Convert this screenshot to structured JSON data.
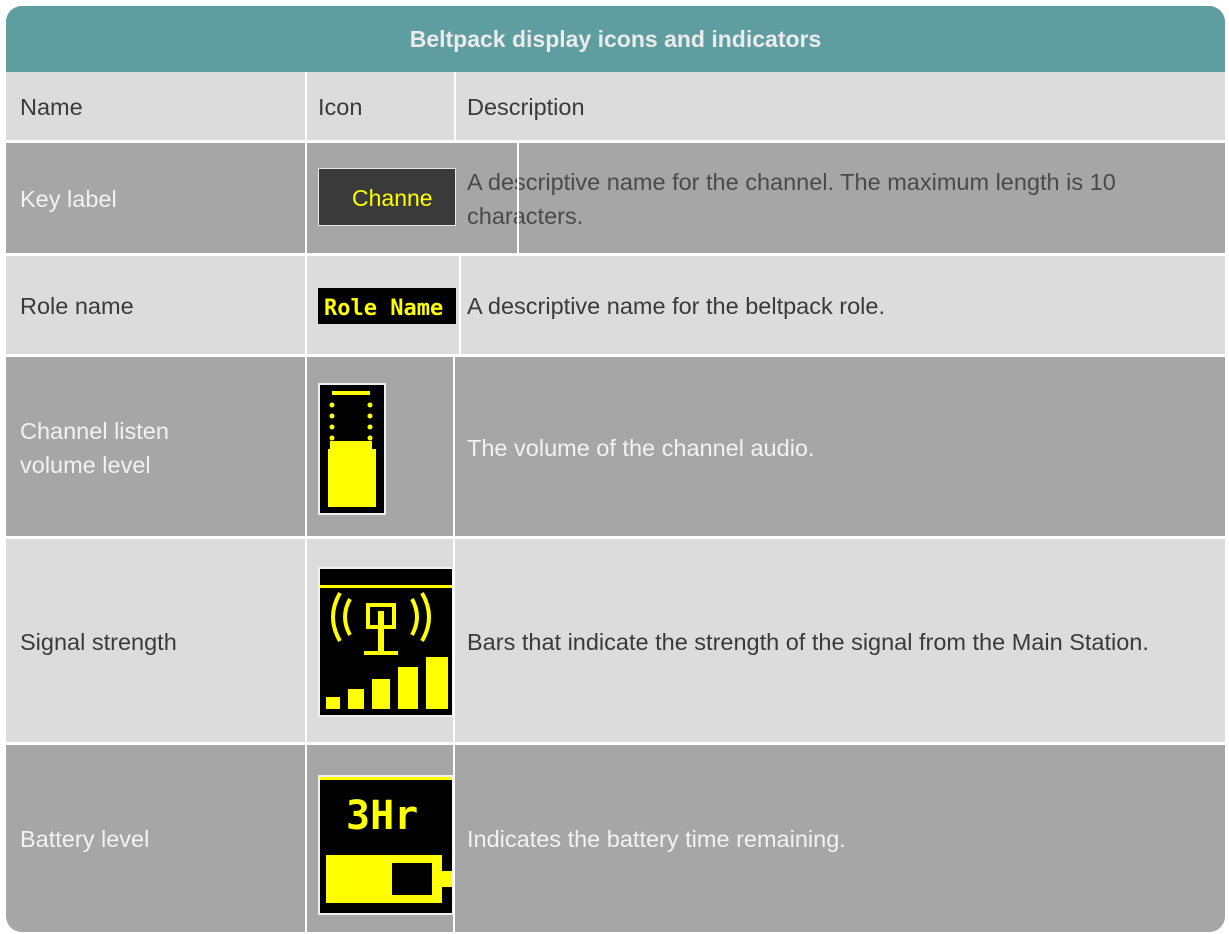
{
  "table": {
    "title": "Beltpack display icons and indicators",
    "headers": {
      "name": "Name",
      "icon": "Icon",
      "description": "Description"
    },
    "rows": [
      {
        "name": "Key label",
        "icon": "key-label-display-icon",
        "icon_text": "Channe",
        "description": "A descriptive name for the channel. The maximum length is 10 characters."
      },
      {
        "name": "Role name",
        "icon": "role-name-display-icon",
        "icon_text": "Role Name",
        "description": "A descriptive name for the beltpack role."
      },
      {
        "name": "Channel listen volume level",
        "icon": "volume-level-icon",
        "description": "The volume of the channel audio."
      },
      {
        "name": "Signal strength",
        "icon": "signal-strength-icon",
        "description": "Bars that indicate the strength of the signal from the Main Station."
      },
      {
        "name": "Battery level",
        "icon": "battery-level-icon",
        "icon_text": "3Hr",
        "description": "Indicates the battery time remaining."
      }
    ]
  },
  "colors": {
    "title_bar": "#5f9ea0",
    "row_light": "#dcdcdc",
    "row_dark": "#a6a6a6",
    "display_yellow": "#ffff00",
    "display_black": "#000000"
  }
}
